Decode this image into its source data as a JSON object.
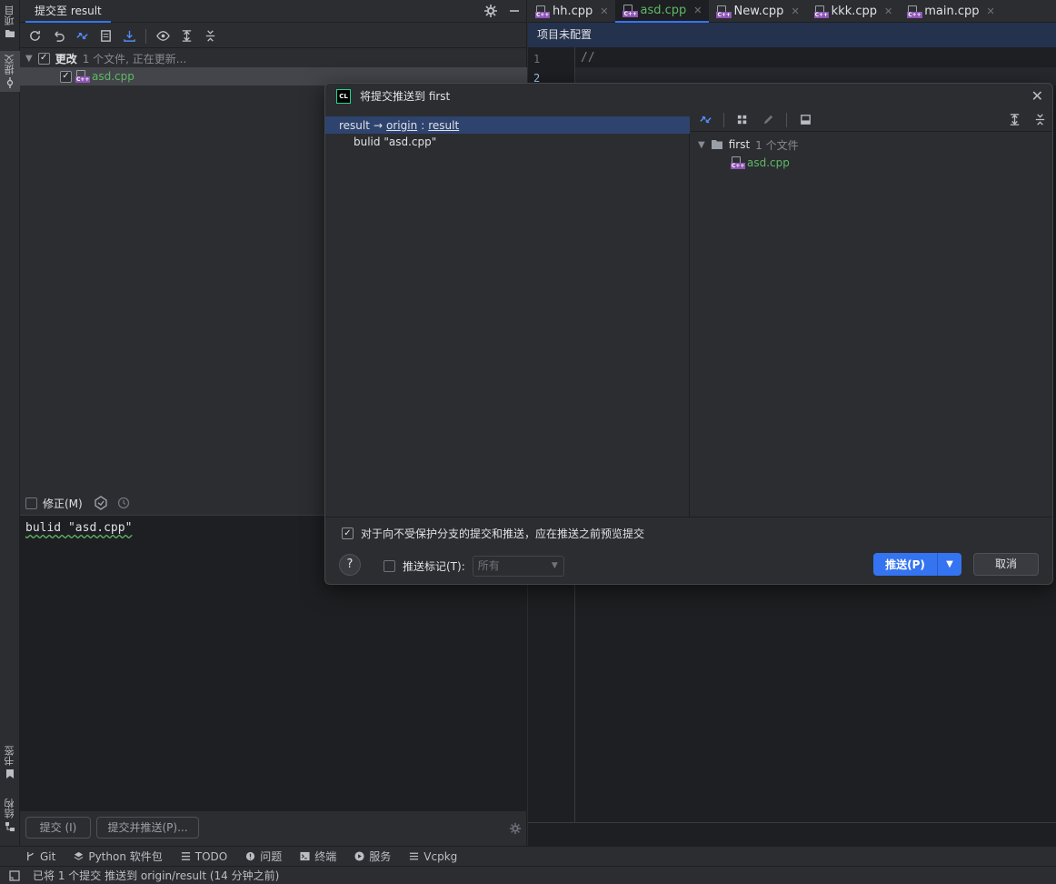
{
  "left_strip": {
    "project_label": "项目",
    "commit_label": "提交",
    "bookmarks_label": "书签",
    "structure_label": "结构"
  },
  "commit_panel": {
    "tab_title": "提交至 result",
    "changes_label": "更改",
    "changes_info": "1 个文件, 正在更新...",
    "file_name": "asd.cpp",
    "amend_label": "修正(M)",
    "message": "bulid \"asd.cpp\"",
    "commit_button": "提交 (I)",
    "commit_push_button": "提交并推送(P)..."
  },
  "editor": {
    "tabs": [
      {
        "name": "hh.cpp",
        "active": false
      },
      {
        "name": "asd.cpp",
        "active": true
      },
      {
        "name": "New.cpp",
        "active": false
      },
      {
        "name": "kkk.cpp",
        "active": false
      },
      {
        "name": "main.cpp",
        "active": false
      }
    ],
    "banner": "项目未配置",
    "line1": "1",
    "line2": "2",
    "code_line1": "//"
  },
  "dialog": {
    "title": "将提交推送到 first",
    "logo_text": "CL",
    "push_source": "result",
    "arrow": "→",
    "remote": "origin",
    "colon": ":",
    "target_branch": "result",
    "commit_message": "bulid \"asd.cpp\"",
    "tree_folder": "first",
    "tree_folder_info": "1 个文件",
    "tree_file": "asd.cpp",
    "preview_checkbox_label": "对于向不受保护分支的提交和推送，应在推送之前预览提交",
    "push_tags_label": "推送标记(T):",
    "tags_select_value": "所有",
    "push_button": "推送(P)",
    "cancel_button": "取消",
    "help": "?"
  },
  "bottom_toolbar": {
    "items": [
      "Git",
      "Python 软件包",
      "TODO",
      "问题",
      "终端",
      "服务",
      "Vcpkg"
    ]
  },
  "status": {
    "message": "已将 1 个提交 推送到 origin/result (14 分钟之前)"
  },
  "colors": {
    "accent": "#3574f0",
    "added_file": "#5fb865",
    "selection": "#2e436e"
  }
}
